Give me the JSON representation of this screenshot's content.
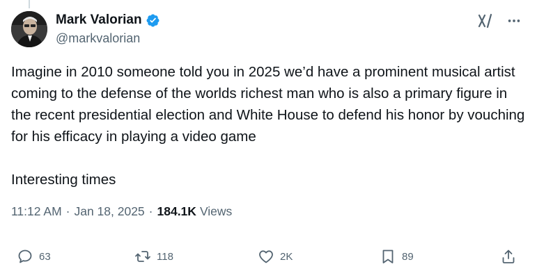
{
  "author": {
    "display_name": "Mark Valorian",
    "handle": "@markvalorian",
    "verified": true,
    "verified_color": "#1d9bf0"
  },
  "tweet": {
    "text": "Imagine in 2010 someone told you in 2025 we’d have a prominent musical artist coming to the defense of the worlds richest man who is also a primary figure in the recent presidential election and White House to defend his honor by vouching for his efficacy in playing a video game\n\nInteresting times",
    "time": "11:12 AM",
    "date": "Jan 18, 2025",
    "separator": "·",
    "views_count": "184.1K",
    "views_label": "Views"
  },
  "actions": {
    "replies": "63",
    "reposts": "118",
    "likes": "2K",
    "bookmarks": "89"
  },
  "icons": {
    "top": [
      "grok-icon",
      "more-icon"
    ],
    "actions": [
      "reply-icon",
      "repost-icon",
      "like-icon",
      "bookmark-icon",
      "share-icon"
    ]
  },
  "colors": {
    "text_primary": "#0f1419",
    "text_secondary": "#536471",
    "accent": "#1d9bf0"
  }
}
